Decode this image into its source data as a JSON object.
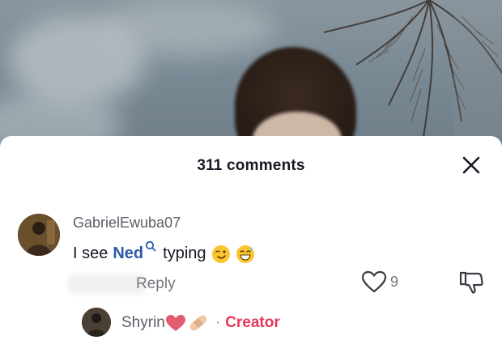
{
  "sheet": {
    "title": "311 comments"
  },
  "icons": {
    "close": "close-icon",
    "like": "heart-outline-icon",
    "dislike": "thumbs-down-icon",
    "mention": "search-icon"
  },
  "comment": {
    "username": "GabrielEwuba07",
    "text_before": "I see",
    "mention": "Ned",
    "text_after": "typing",
    "emojis": [
      "wink-face-emoji",
      "grinning-sweat-emoji"
    ],
    "reply_label": "Reply",
    "like_count": "9"
  },
  "sub_comment": {
    "username": "Shyrin",
    "emojis": [
      "heart-emoji",
      "bandage-emoji"
    ],
    "separator": "·",
    "badge": "Creator"
  },
  "colors": {
    "mention": "#2b5aa8",
    "creator": "#e8365d",
    "text": "#161823",
    "muted": "#75767c"
  }
}
